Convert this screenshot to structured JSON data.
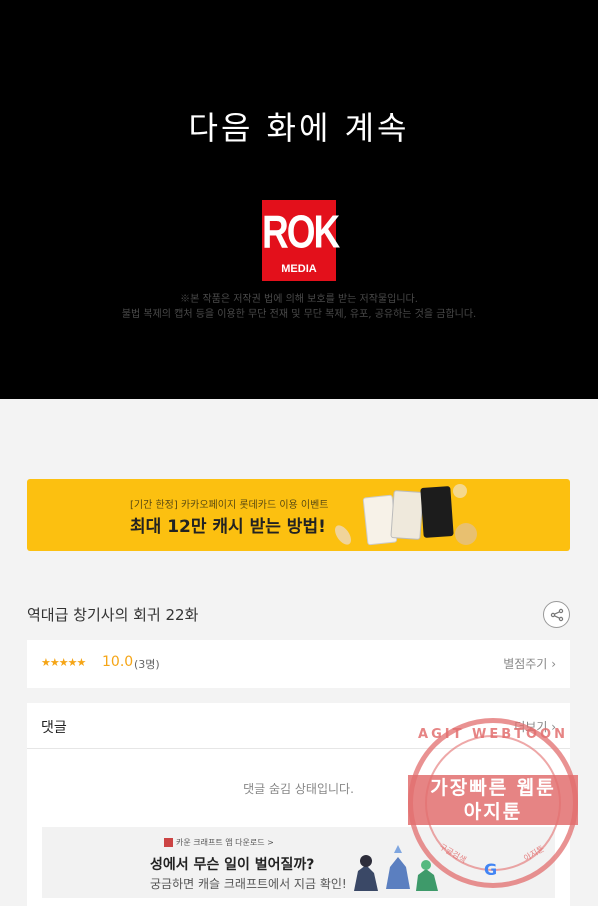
{
  "comic": {
    "continue_text": "다음 화에 계속",
    "publisher_logo_top": "ROK",
    "publisher_logo_bottom": "MEDIA",
    "copyright_line1": "※본 작품은 저작권 법에 의해 보호를 받는 저작물입니다.",
    "copyright_line2": "불법 복제의 캡처 등을 이용한 무단 전재 및 무단 복제, 유포, 공유하는 것을 금합니다."
  },
  "banner": {
    "sub": "[기간 한정] 카카오페이지 롯데카드 이용 이벤트",
    "main": "최대 12만 캐시 받는 방법!"
  },
  "episode": {
    "title": "역대급 창기사의 회귀 22화"
  },
  "rating": {
    "stars": "★★★★★",
    "score": "10.0",
    "count": "(3명)",
    "rate_link": "별점주기"
  },
  "comments": {
    "title": "댓글",
    "more_link": "더보기",
    "hidden_message": "댓글 숨김 상태입니다.",
    "ad_sub": "카운 크래프트 앱 다운로드 >",
    "ad_main": "성에서 무슨 일이 벌어질까?",
    "ad_desc": "궁금하면 캐슬 크래프트에서 지금 확인!"
  },
  "watermark": {
    "top": "AGIT WEBTOON",
    "line1": "가장빠른 웹툰",
    "line2": "아지툰",
    "g": "G",
    "left": "구글검색",
    "right": "아지툰"
  },
  "colors": {
    "accent_star": "#f5a516",
    "banner_bg": "#fcc010",
    "logo_red": "#e3101b",
    "watermark": "#e26e6e"
  },
  "icons": {
    "share": "share-icon",
    "chevron": "chevron-right-icon"
  }
}
